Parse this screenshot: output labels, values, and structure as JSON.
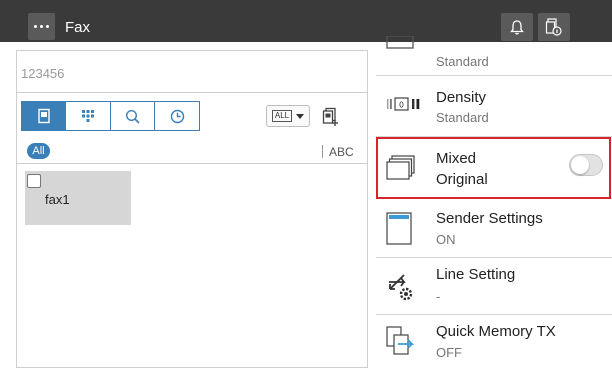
{
  "header": {
    "title": "Fax"
  },
  "address": {
    "fax_number": "123456"
  },
  "toolbar": {
    "all_box_label": "ALL"
  },
  "filter": {
    "all_label": "All",
    "abc_label": "ABC"
  },
  "destinations": [
    {
      "label": "fax1"
    }
  ],
  "settings": [
    {
      "value": "Standard"
    },
    {
      "title": "Density",
      "value": "Standard"
    },
    {
      "title_line1": "Mixed",
      "title_line2": "Original",
      "toggle_on": false
    },
    {
      "title": "Sender Settings",
      "value": "ON"
    },
    {
      "title": "Line Setting",
      "value": "-"
    },
    {
      "title": "Quick Memory TX",
      "value": "OFF"
    }
  ],
  "colors": {
    "topbar": "#3a3a3a",
    "accent_blue": "#3a7fb8",
    "highlight_red": "#d9232d"
  },
  "icons": [
    "more-icon",
    "bell-icon",
    "job-status-icon",
    "fax-address-book-icon",
    "keypad-icon",
    "search-icon",
    "history-icon",
    "add-destination-icon",
    "density-icon",
    "mixed-original-icon",
    "sender-settings-icon",
    "line-setting-icon",
    "quick-memory-tx-icon"
  ]
}
